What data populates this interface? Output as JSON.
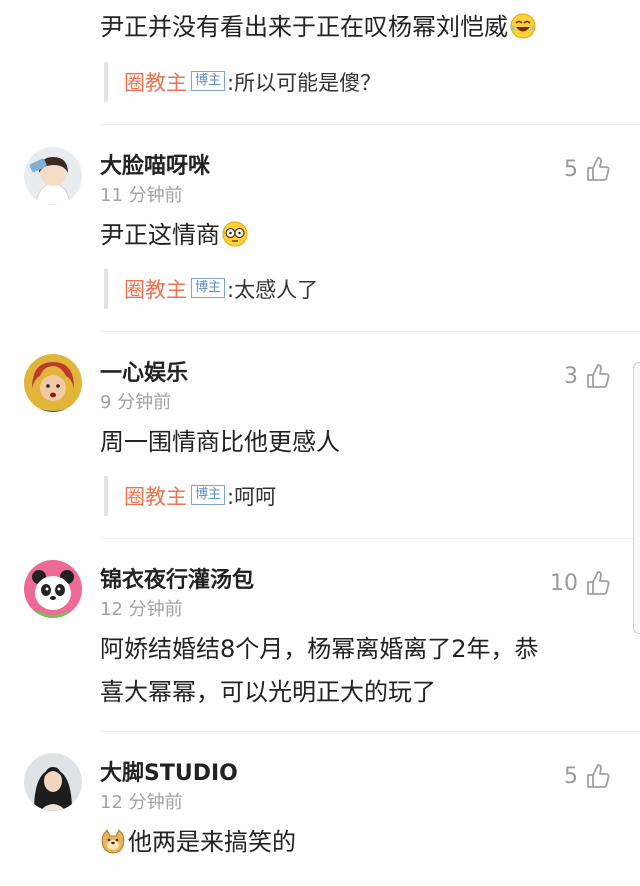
{
  "top_partial": {
    "text": "尹正并没有看出来于正在叹杨幂刘恺威",
    "emoji": "laugh-crying-emoji",
    "reply": {
      "name": "圈教主",
      "badge": "博主",
      "text": ":所以可能是傻？"
    }
  },
  "comments": [
    {
      "user": "大脸喵呀咪",
      "time": "11 分钟前",
      "likes": "5",
      "text": "尹正这情商",
      "emoji": "speechless-emoji",
      "reply": {
        "name": "圈教主",
        "badge": "博主",
        "text": ":太感人了"
      }
    },
    {
      "user": "一心娱乐",
      "time": "9 分钟前",
      "likes": "3",
      "text": "周一围情商比他更感人",
      "reply": {
        "name": "圈教主",
        "badge": "博主",
        "text": ":呵呵"
      }
    },
    {
      "user": "锦衣夜行灌汤包",
      "time": "12 分钟前",
      "likes": "10",
      "text_line1": "阿娇结婚结8个月，杨幂离婚离了2年，恭",
      "text_line2": "喜大幂幂，可以光明正大的玩了"
    },
    {
      "user": "大脚STUDIO",
      "time": "12 分钟前",
      "likes": "5",
      "emoji": "doge-emoji",
      "text": "他两是来搞笑的"
    }
  ],
  "colors": {
    "reply_name": "#eb7350",
    "badge": "#5d8fc0",
    "secondary_text": "#a3a3a3",
    "divider": "#ececec"
  }
}
